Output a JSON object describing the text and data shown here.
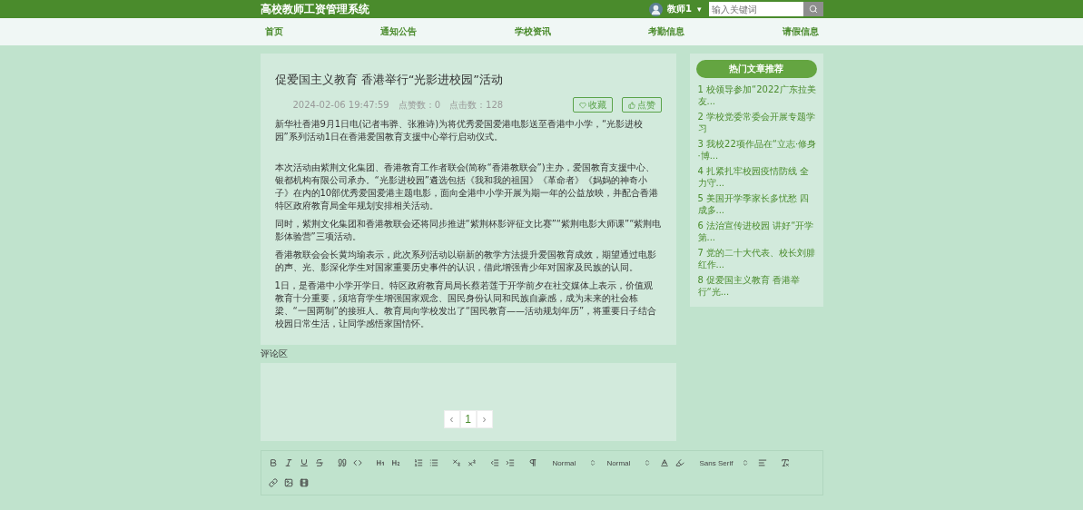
{
  "header": {
    "title": "高校教师工资管理系统",
    "user": "教师1",
    "caret": "▾",
    "search": {
      "placeholder": "输入关键词"
    }
  },
  "nav": [
    {
      "label": "首页",
      "selected": false
    },
    {
      "label": "通知公告",
      "selected": false
    },
    {
      "label": "学校资讯",
      "selected": false
    },
    {
      "label": "考勤信息",
      "selected": false
    },
    {
      "label": "请假信息",
      "selected": false
    }
  ],
  "article": {
    "title": "促爱国主义教育 香港举行“光影进校园”活动",
    "date": "2024-02-06 19:47:59",
    "likes": "点赞数：0",
    "clicks": "点击数：128",
    "buttons": [
      {
        "kind": "favorite",
        "label": "收藏"
      },
      {
        "kind": "like",
        "label": "点赞"
      }
    ],
    "paragraphs": [
      {
        "kind": "text",
        "text": "新华社香港9月1日电(记者韦骅、张雅诗)为将优秀爱国爱港电影送至香港中小学，“光影进校园”系列活动1日在香港爱国教育支援中心举行启动仪式。"
      },
      {
        "kind": "blank"
      },
      {
        "kind": "text",
        "text": "本次活动由紫荆文化集团、香港教育工作者联会(简称“香港教联会”)主办，爱国教育支援中心、银都机构有限公司承办。“光影进校园”遴选包括《我和我的祖国》《革命者》《妈妈的神奇小子》在内的10部优秀爱国爱港主题电影，面向全港中小学开展为期一年的公益放映，并配合香港特区政府教育局全年规划安排相关活动。"
      },
      {
        "kind": "text",
        "text": "同时，紫荆文化集团和香港教联会还将同步推进“紫荆杯影评征文比赛”“紫荆电影大师课”“紫荆电影体验营”三项活动。"
      },
      {
        "kind": "text",
        "text": "香港教联会会长黄均瑜表示，此次系列活动以崭新的教学方法提升爱国教育成效，期望通过电影的声、光、影深化学生对国家重要历史事件的认识，借此增强青少年对国家及民族的认同。"
      },
      {
        "kind": "text",
        "text": "1日，是香港中小学开学日。特区政府教育局局长蔡若莲于开学前夕在社交媒体上表示，价值观教育十分重要，须培育学生增强国家观念、国民身份认同和民族自豪感，成为未来的社会栋梁、“一国两制”的接班人。教育局向学校发出了“国民教育——活动规划年历”，将重要日子结合校园日常生活，让同学感悟家国情怀。"
      }
    ]
  },
  "sidebar": {
    "title": "热门文章推荐",
    "items": [
      {
        "index": "1",
        "title": "校领导参加“2022广东拉美友..."
      },
      {
        "index": "2",
        "title": "学校党委常委会开展专题学习"
      },
      {
        "index": "3",
        "title": "我校22项作品在“立志·修身·博..."
      },
      {
        "index": "4",
        "title": "扎紧扎牢校园疫情防线 全力守..."
      },
      {
        "index": "5",
        "title": "美国开学季家长多忧愁 四成多..."
      },
      {
        "index": "6",
        "title": "法治宣传进校园 讲好“开学第..."
      },
      {
        "index": "7",
        "title": "党的二十大代表、校长刘腓红作..."
      },
      {
        "index": "8",
        "title": "促爱国主义教育 香港举行“光..."
      }
    ]
  },
  "comments": {
    "title": "评论区",
    "pagination": [
      {
        "label": "‹",
        "selected": false
      },
      {
        "label": "1",
        "selected": true
      },
      {
        "label": "›",
        "selected": false
      }
    ]
  },
  "editor": {
    "selects": [
      {
        "value": "Normal"
      },
      {
        "value": "Normal"
      },
      {
        "value": "Sans Serif"
      }
    ]
  }
}
